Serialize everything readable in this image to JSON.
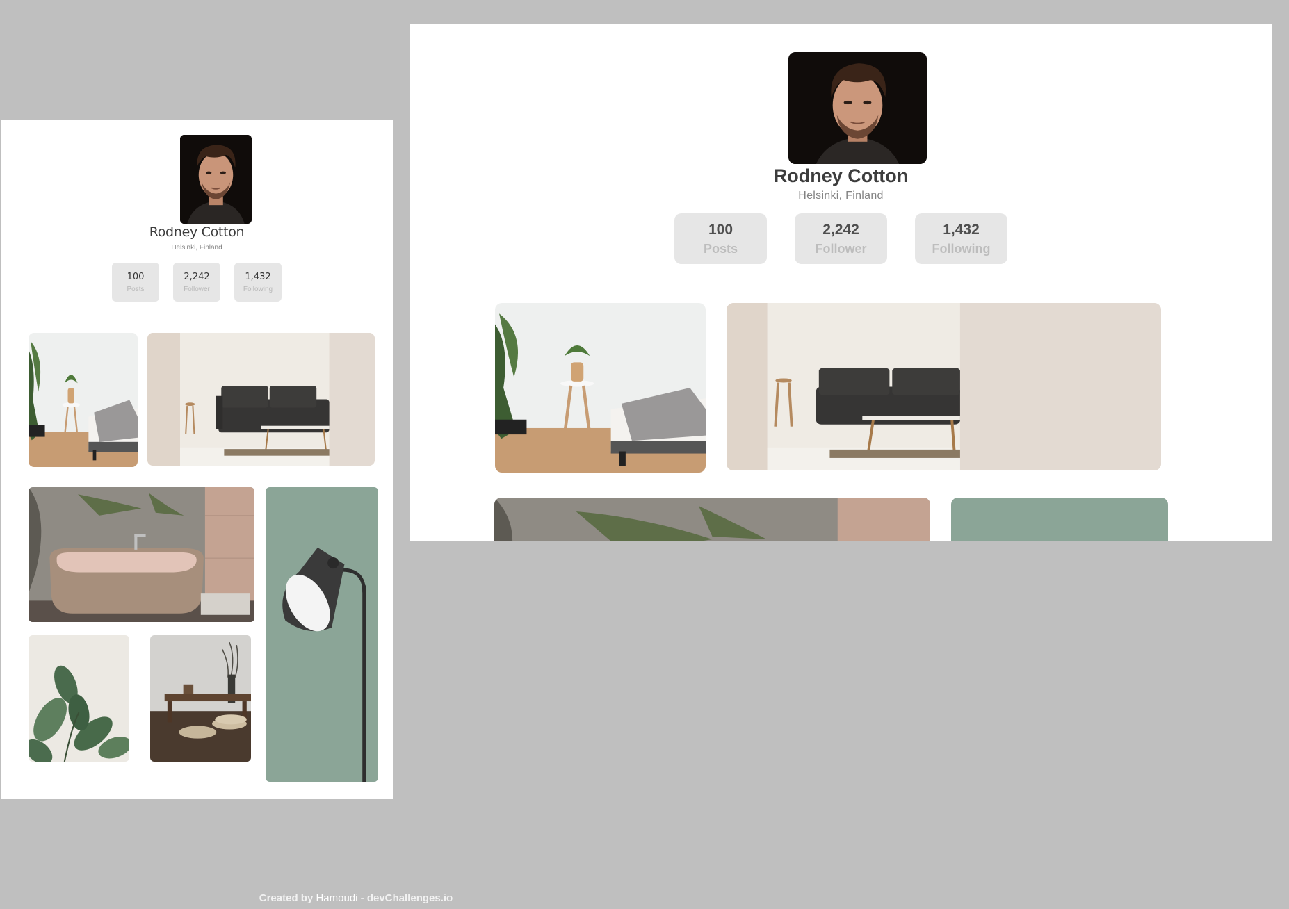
{
  "profile": {
    "name": "Rodney Cotton",
    "location": "Helsinki, Finland",
    "avatar_icon": "profile-photo",
    "stats": [
      {
        "value": "100",
        "label": "Posts"
      },
      {
        "value": "2,242",
        "label": "Follower"
      },
      {
        "value": "1,432",
        "label": "Following"
      }
    ]
  },
  "gallery": [
    {
      "name": "bedroom-plant-photo"
    },
    {
      "name": "living-room-sofa-photo"
    },
    {
      "name": "bathtub-photo"
    },
    {
      "name": "floor-lamp-photo"
    },
    {
      "name": "rubber-plant-photo"
    },
    {
      "name": "bench-cushions-photo"
    }
  ],
  "colors": {
    "page_bg": "#bfbfbf",
    "card_bg": "#ffffff",
    "name_text": "#3d3d3d",
    "stat_bg": "#e6e6e6",
    "stat_label": "#bdbdbd",
    "sage": "#8ba597"
  },
  "footer": {
    "prefix": "Created by",
    "author": "Hamoudi",
    "suffix": "- devChallenges.io"
  }
}
